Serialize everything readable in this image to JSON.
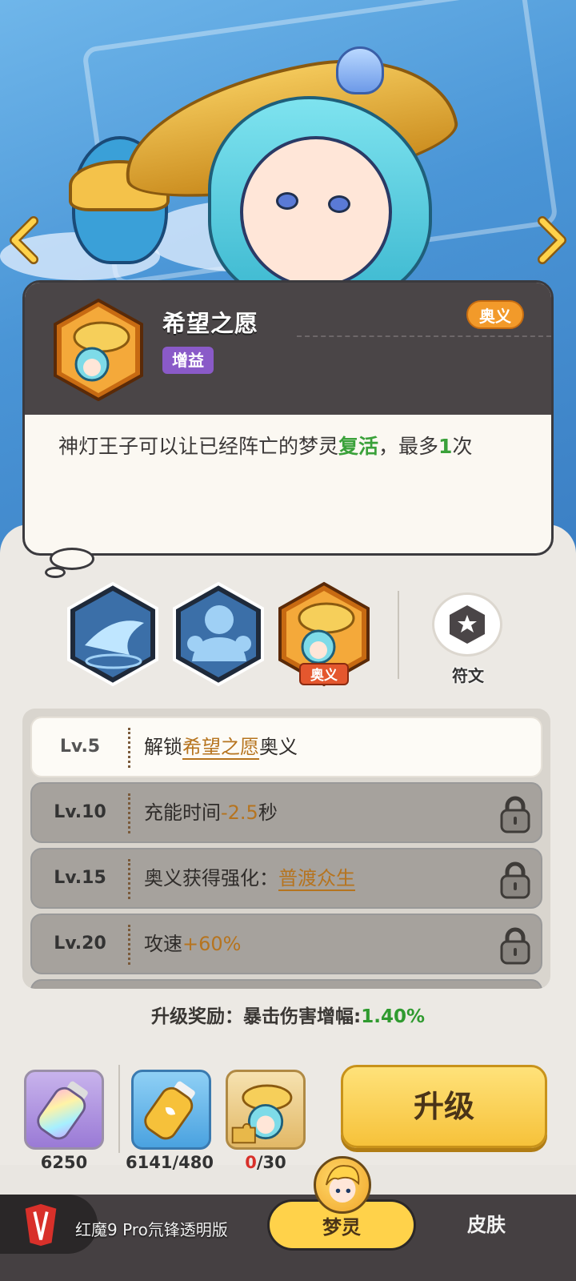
{
  "nav": {
    "prev_icon": "chevron-left-icon",
    "next_icon": "chevron-right-icon"
  },
  "skill_card": {
    "title": "希望之愿",
    "tag_buff": "增益",
    "tag_ult": "奥义",
    "description_before": "神灯王子可以让已经阵亡的梦灵",
    "description_highlight": "复活",
    "description_mid": "，最多",
    "description_count": "1",
    "description_after": "次"
  },
  "skill_slots": [
    {
      "name": "skill-1",
      "icon": "flying-genie-icon"
    },
    {
      "name": "skill-2",
      "icon": "genie-muscle-icon"
    },
    {
      "name": "skill-ult",
      "icon": "genie-lamp-portrait-icon",
      "badge": "奥义"
    }
  ],
  "rune": {
    "label": "符文",
    "icon": "hexagon-star-icon"
  },
  "levels": [
    {
      "level": "Lv.5",
      "pre": "解锁",
      "highlight": "希望之愿",
      "post": "奥义",
      "locked": false
    },
    {
      "level": "Lv.10",
      "pre": "充能时间",
      "highlight": "-2.5",
      "post": "秒",
      "locked": true
    },
    {
      "level": "Lv.15",
      "pre": "奥义获得强化：",
      "highlight": "普渡众生",
      "post": "",
      "locked": true
    },
    {
      "level": "Lv.20",
      "pre": "攻速",
      "highlight": "+60%",
      "post": "",
      "locked": true
    }
  ],
  "reward": {
    "label": "升级奖励：暴击伤害增幅:",
    "value": "1.40%"
  },
  "items": [
    {
      "name": "rainbow-bottle",
      "count": "6250"
    },
    {
      "name": "gold-bottle",
      "count": "6141/480"
    },
    {
      "name": "genie-fragment",
      "count_have": "0",
      "count_need": "/30"
    }
  ],
  "upgrade_button": "升级",
  "bottom_bar": {
    "brand_text": "红魔9 Pro氘锋透明版",
    "tab_active": "梦灵",
    "tab_skin": "皮肤"
  },
  "colors": {
    "accent": "#ffd24a",
    "highlight_green": "#3aa13a",
    "highlight_gold": "#b6741f",
    "ult_orange": "#f29a2a",
    "buff_purple": "#8a5ac8"
  }
}
